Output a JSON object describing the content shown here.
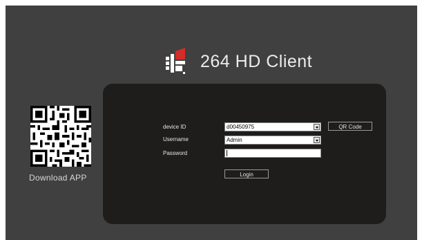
{
  "app": {
    "title": "264 HD Client"
  },
  "qr": {
    "caption": "Download APP"
  },
  "login": {
    "device_id_label": "device ID",
    "device_id_value": "d00450975",
    "username_label": "Username",
    "username_value": "Admin",
    "password_label": "Password",
    "password_value": "",
    "qr_button_label": "QR Code",
    "login_button_label": "Login"
  },
  "colors": {
    "background": "#404040",
    "panel": "#1e1d1b",
    "logo_red": "#d32d27",
    "logo_white": "#ffffff"
  },
  "icons": [
    "logo-icon",
    "qr-code-icon",
    "dropdown-arrow-icon"
  ]
}
